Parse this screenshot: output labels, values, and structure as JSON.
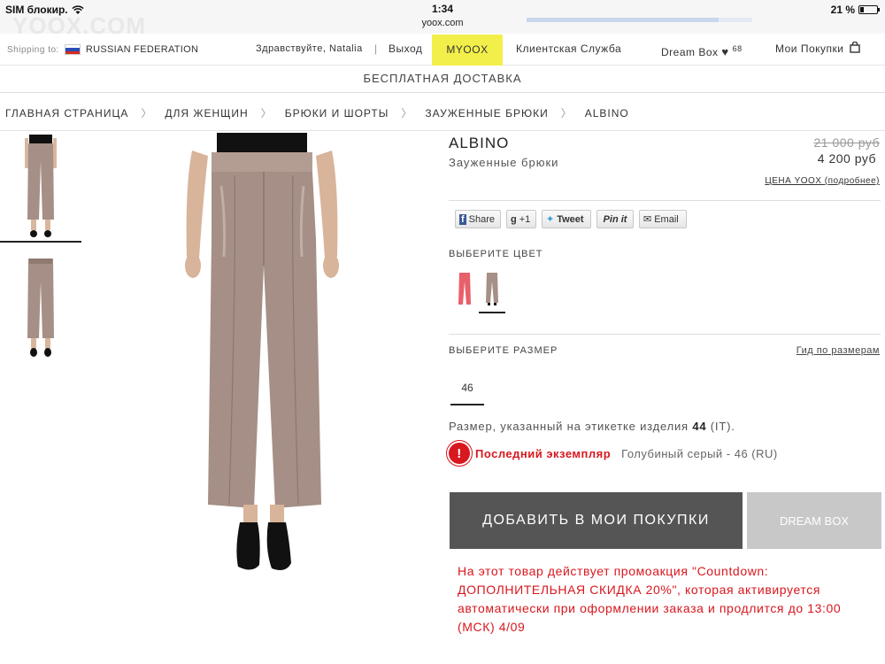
{
  "status_bar": {
    "carrier": "SIM блокир.",
    "time": "1:34",
    "url": "yoox.com",
    "battery": "21 %",
    "battery_level": 0.21,
    "watermark": "YOOX.COM",
    "page_load_progress": 0.85
  },
  "topnav": {
    "shipping_label": "Shipping to:",
    "country": "RUSSIAN FEDERATION",
    "greeting": "Здравствуйте, Natalia",
    "separator": "|",
    "logout": "Выход",
    "myoox": "MYOOX",
    "service": "Клиентская Служба",
    "dreambox": "Dream Box",
    "dreambox_count": "68",
    "purchases": "Мои Покупки",
    "colors": {
      "myoox_bg": "#f3ef4a"
    }
  },
  "banner": {
    "free_shipping": "БЕСПЛАТНАЯ ДОСТАВКА"
  },
  "breadcrumb": {
    "items": [
      "ГЛАВНАЯ СТРАНИЦА",
      "ДЛЯ ЖЕНЩИН",
      "БРЮКИ И ШОРТЫ",
      "ЗАУЖЕННЫЕ БРЮКИ",
      "ALBINO"
    ],
    "separator": "〉"
  },
  "product": {
    "brand": "ALBINO",
    "type": "Зауженные брюки",
    "old_price": "21 000 руб",
    "price": "4 200 руб",
    "price_note": "ЦЕНА YOOX (подробнее)"
  },
  "share": {
    "facebook": "Share",
    "gplus": "+1",
    "twitter": "Tweet",
    "pinterest": "Pin it",
    "email": "Email"
  },
  "color": {
    "label": "ВЫБЕРИТЕ ЦВЕТ",
    "swatches": [
      {
        "name": "coral",
        "hex": "#e8606a"
      },
      {
        "name": "taupe",
        "hex": "#a58f86",
        "selected": true
      }
    ]
  },
  "size": {
    "label": "ВЫБЕРИТЕ РАЗМЕР",
    "guide": "Гид по размерам",
    "options": [
      "46"
    ],
    "note_prefix": "Размер, указанный на этикетке изделия",
    "note_value": "44",
    "note_suffix": "(IT)."
  },
  "stock": {
    "icon": "!",
    "last_item": "Последний экземпляр",
    "detail": "Голубиный серый - 46 (RU)"
  },
  "actions": {
    "add_to_cart": "ДОБАВИТЬ В МОИ ПОКУПКИ",
    "dream_box": "DREAM BOX"
  },
  "promo": {
    "text": "На этот товар действует промоакция \"Countdown: ДОПОЛНИТЕЛЬНАЯ СКИДКА 20%\", которая активируется автоматически при оформлении заказа и продлится до 13:00 (МСК) 4/09"
  },
  "accent_colors": {
    "red": "#d8171e",
    "button_dark": "#555555",
    "button_light": "#c8c8c8"
  }
}
